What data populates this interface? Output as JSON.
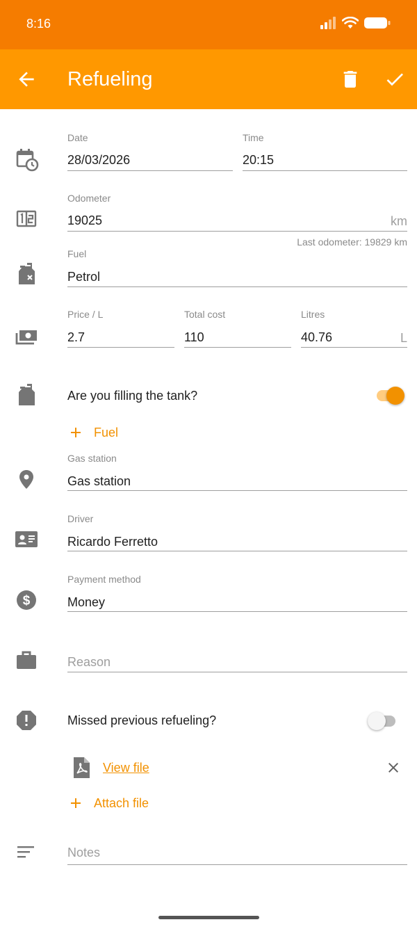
{
  "status_bar": {
    "time": "8:16"
  },
  "app_bar": {
    "title": "Refueling"
  },
  "date": {
    "label": "Date",
    "value": "28/03/2026"
  },
  "time": {
    "label": "Time",
    "value": "20:15"
  },
  "odometer": {
    "label": "Odometer",
    "value": "19025",
    "unit": "km",
    "hint": "Last odometer: 19829 km"
  },
  "fuel": {
    "label": "Fuel",
    "value": "Petrol"
  },
  "price": {
    "label": "Price / L",
    "value": "2.7"
  },
  "total_cost": {
    "label": "Total cost",
    "value": "110"
  },
  "litres": {
    "label": "Litres",
    "value": "40.76",
    "unit": "L"
  },
  "fill_tank": {
    "label": "Are you filling the tank?",
    "on": true
  },
  "add_fuel": {
    "label": "Fuel"
  },
  "gas_station": {
    "label": "Gas station",
    "value": "Gas station"
  },
  "driver": {
    "label": "Driver",
    "value": "Ricardo Ferretto"
  },
  "payment_method": {
    "label": "Payment method",
    "value": "Money"
  },
  "reason": {
    "placeholder": "Reason"
  },
  "missed_refueling": {
    "label": "Missed previous refueling?",
    "on": false
  },
  "attachment": {
    "link": "View file"
  },
  "attach_file": {
    "label": "Attach file"
  },
  "notes": {
    "placeholder": "Notes"
  },
  "colors": {
    "status_bar": "#f57c00",
    "app_bar": "#ff9800",
    "accent": "#f29100",
    "icon_gray": "#757575"
  }
}
